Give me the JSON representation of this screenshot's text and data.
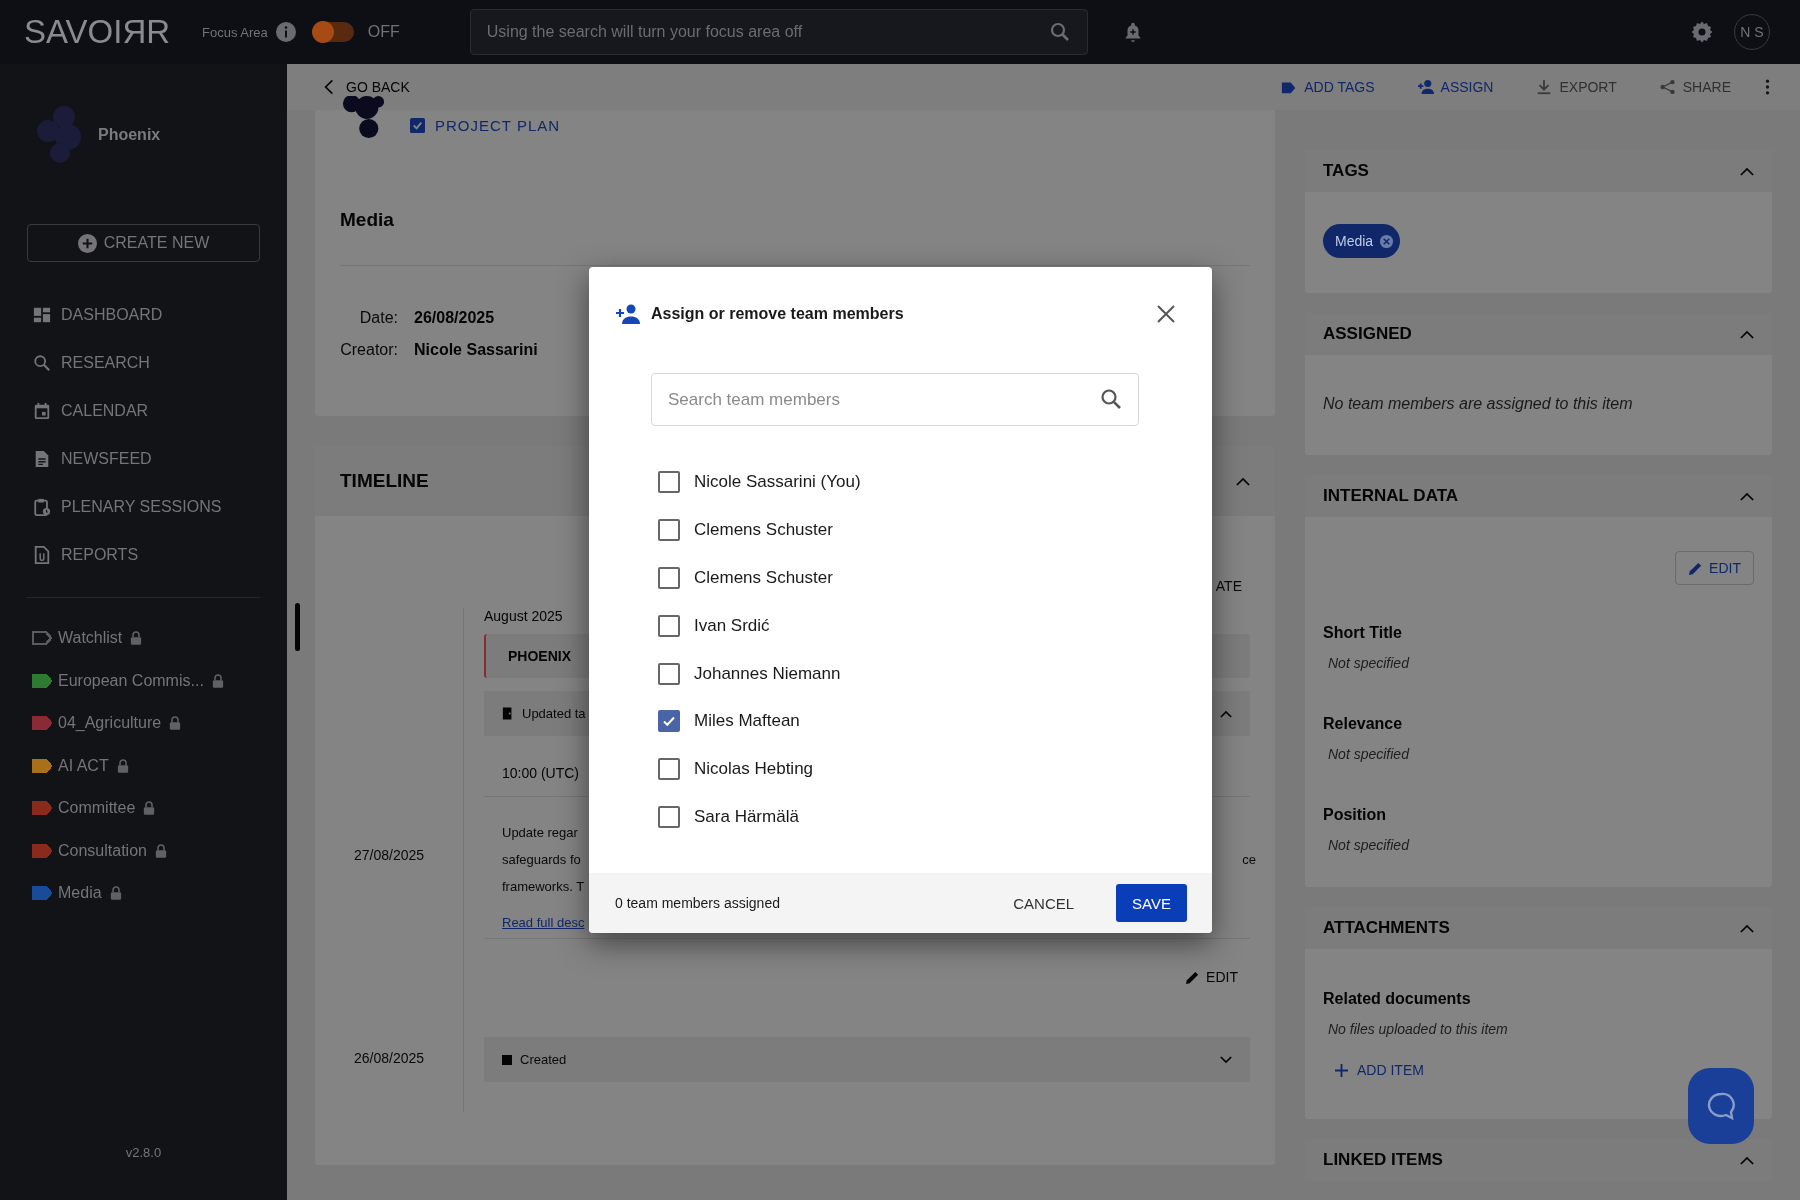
{
  "topbar": {
    "logo": "SAVOIЯR",
    "focus_label": "Focus Area",
    "focus_toggle": {
      "on": false,
      "label": "OFF"
    },
    "search": {
      "placeholder": "Using the search will turn your focus area off"
    },
    "avatar": "N S"
  },
  "sidebar": {
    "workspace": "Phoenix",
    "create_button": "CREATE NEW",
    "nav": [
      {
        "label": "DASHBOARD",
        "kind": "dashboard"
      },
      {
        "label": "RESEARCH",
        "kind": "search"
      },
      {
        "label": "CALENDAR",
        "kind": "calendar"
      },
      {
        "label": "NEWSFEED",
        "kind": "document"
      },
      {
        "label": "PLENARY SESSIONS",
        "kind": "clipboard"
      },
      {
        "label": "REPORTS",
        "kind": "report"
      }
    ],
    "tags": [
      {
        "label": "Watchlist",
        "color": "#5a5a60",
        "outlined": true
      },
      {
        "label": "European Commis...",
        "color": "#2e7a32",
        "outlined": false
      },
      {
        "label": "04_Agriculture",
        "color": "#8a2a34",
        "outlined": false
      },
      {
        "label": "AI ACT",
        "color": "#a87018",
        "outlined": false
      },
      {
        "label": "Committee",
        "color": "#8a2a1c",
        "outlined": false
      },
      {
        "label": "Consultation",
        "color": "#8a2a1c",
        "outlined": false
      },
      {
        "label": "Media",
        "color": "#1a4a9a",
        "outlined": false
      }
    ],
    "version": "v2.8.0"
  },
  "toolbar": {
    "back": "GO BACK",
    "actions": [
      {
        "label": "ADD TAGS",
        "kind": "tag",
        "disabled": false
      },
      {
        "label": "ASSIGN",
        "kind": "assign",
        "disabled": false
      },
      {
        "label": "EXPORT",
        "kind": "export",
        "disabled": true
      },
      {
        "label": "SHARE",
        "kind": "share",
        "disabled": true
      }
    ]
  },
  "item": {
    "type_label": "PROJECT PLAN",
    "title": "Media",
    "fields": [
      {
        "label": "Date:",
        "value": "26/08/2025"
      },
      {
        "label": "Creator:",
        "value": "Nicole Sassarini"
      }
    ]
  },
  "timeline": {
    "title": "TIMELINE",
    "expanded": true,
    "sort_fragment": "ATE",
    "month": "August 2025",
    "group": "PHOENIX",
    "entries": [
      {
        "date": "27/08/2025",
        "event": "Updated ta",
        "expanded": true,
        "time": "10:00 (UTC)",
        "description": [
          {
            "start": "Update regar"
          },
          {
            "start": "safeguards fo",
            "end": "ce"
          },
          {
            "start": "frameworks. T"
          }
        ],
        "link": "Read full desc",
        "edit": "EDIT"
      },
      {
        "date": "26/08/2025",
        "event": "Created",
        "expanded": false
      }
    ]
  },
  "panels": [
    {
      "title": "TAGS",
      "kind": "tags",
      "expanded": true,
      "tags": [
        "Media"
      ]
    },
    {
      "title": "ASSIGNED",
      "kind": "assigned",
      "expanded": true,
      "empty_text": "No team members are assigned to this item"
    },
    {
      "title": "INTERNAL DATA",
      "kind": "fields",
      "expanded": true,
      "edit": "EDIT",
      "fields": [
        {
          "label": "Short Title",
          "value": "Not specified"
        },
        {
          "label": "Relevance",
          "value": "Not specified"
        },
        {
          "label": "Position",
          "value": "Not specified"
        }
      ]
    },
    {
      "title": "ATTACHMENTS",
      "kind": "attachments",
      "expanded": true,
      "subtitle": "Related documents",
      "empty_text": "No files uploaded to this item",
      "add": "ADD ITEM"
    },
    {
      "title": "LINKED ITEMS",
      "kind": "linked",
      "expanded": true
    }
  ],
  "modal": {
    "title": "Assign or remove team members",
    "search_placeholder": "Search team members",
    "members": [
      {
        "name": "Nicole Sassarini (You)",
        "checked": false
      },
      {
        "name": "Clemens Schuster",
        "checked": false
      },
      {
        "name": "Clemens Schuster",
        "checked": false
      },
      {
        "name": "Ivan Srdić",
        "checked": false
      },
      {
        "name": "Johannes Niemann",
        "checked": false
      },
      {
        "name": "Miles Maftean",
        "checked": true
      },
      {
        "name": "Nicolas Hebting",
        "checked": false
      },
      {
        "name": "Sara Härmälä",
        "checked": false
      }
    ],
    "summary": "0 team members assigned",
    "buttons": [
      {
        "label": "CANCEL",
        "kind": "text"
      },
      {
        "label": "SAVE",
        "kind": "primary"
      }
    ]
  }
}
